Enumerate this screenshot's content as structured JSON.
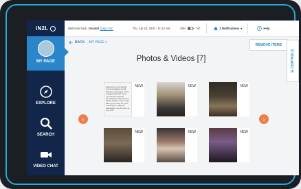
{
  "app": {
    "brand": "iN2L"
  },
  "nav": {
    "my_page": "MY PAGE",
    "explore": "EXPLORE",
    "search": "SEARCH",
    "video_chat": "VIDEO CHAT"
  },
  "topbar": {
    "welcome_prefix": "Welcome back,",
    "user": "Donald!",
    "sign_out": "(Sign Out)",
    "datetime": "Thu, Apr 16, 2020 - 11:22 AM",
    "battery": "39%",
    "notifications": "2 Notifications",
    "help": "Help"
  },
  "subbar": {
    "back": "BACK",
    "breadcrumb": "MY PAGE >",
    "remove_items": "REMOVE ITEMS"
  },
  "page": {
    "title": "Photos & Videos [7]",
    "controls": "CONTROLS"
  },
  "tiles": [
    {
      "badge": "NEW",
      "kind": "note",
      "note_text": "Welcome to the Family Communication portal. Sending messages to the resident will help keep your family member connected to friends and family. Please note it may take up to a day for your messages to appear. Messages may be sent at any time."
    },
    {
      "badge": "NEW",
      "kind": "photo"
    },
    {
      "badge": "NEW",
      "kind": "photo"
    },
    {
      "badge": "NEW",
      "kind": "photo"
    },
    {
      "badge": "NEW",
      "kind": "photo"
    },
    {
      "badge": "NEW",
      "kind": "photo"
    }
  ],
  "colors": {
    "sidebar": "#12264a",
    "accent": "#2a86c9",
    "arrow": "#f07c4a",
    "tablet_trim": "#26a8d8"
  },
  "icons": [
    "avatar-photo",
    "compass-icon",
    "search-icon",
    "video-camera-icon",
    "chevron-left-icon",
    "chevron-right-icon",
    "wifi-icon",
    "battery-icon",
    "bell-icon",
    "help-icon"
  ]
}
